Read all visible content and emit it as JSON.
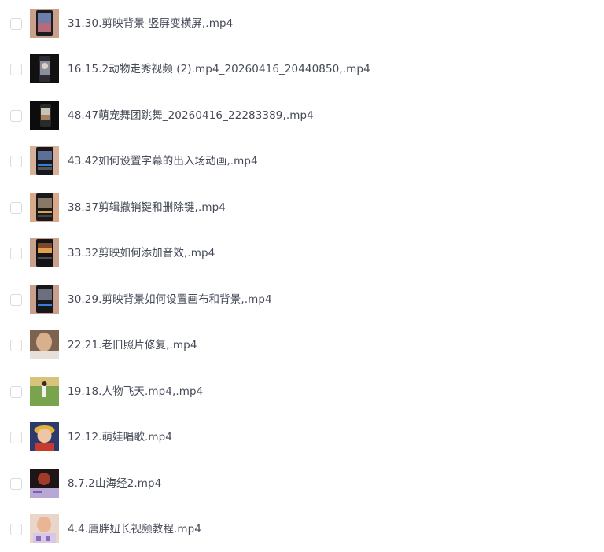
{
  "files": [
    {
      "name": "31.30.剪映背景-竖屏变横屏,.mp4",
      "thumbnail": "video-thumbnail-phone-screen"
    },
    {
      "name": "16.15.2动物走秀视频 (2).mp4_20260416_20440850,.mp4",
      "thumbnail": "video-thumbnail-phone-screen"
    },
    {
      "name": "48.47萌宠舞团跳舞_20260416_22283389,.mp4",
      "thumbnail": "video-thumbnail-phone-screen"
    },
    {
      "name": "43.42如何设置字幕的出入场动画,.mp4",
      "thumbnail": "video-thumbnail-editor"
    },
    {
      "name": "38.37剪辑撤销键和删除键,.mp4",
      "thumbnail": "video-thumbnail-editor"
    },
    {
      "name": "33.32剪映如何添加音效,.mp4",
      "thumbnail": "video-thumbnail-editor"
    },
    {
      "name": "30.29.剪映背景如何设置画布和背景,.mp4",
      "thumbnail": "video-thumbnail-editor"
    },
    {
      "name": "22.21.老旧照片修复,.mp4",
      "thumbnail": "video-thumbnail-portrait"
    },
    {
      "name": "19.18.人物飞天.mp4,.mp4",
      "thumbnail": "video-thumbnail-landscape"
    },
    {
      "name": "12.12.萌娃唱歌.mp4",
      "thumbnail": "video-thumbnail-child"
    },
    {
      "name": "8.7.2山海经2.mp4",
      "thumbnail": "video-thumbnail-fantasy"
    },
    {
      "name": "4.4.唐胖妞长视频教程.mp4",
      "thumbnail": "video-thumbnail-portrait"
    }
  ],
  "colors": {
    "text": "#454a57",
    "checkbox_border": "#d9dbe1"
  }
}
